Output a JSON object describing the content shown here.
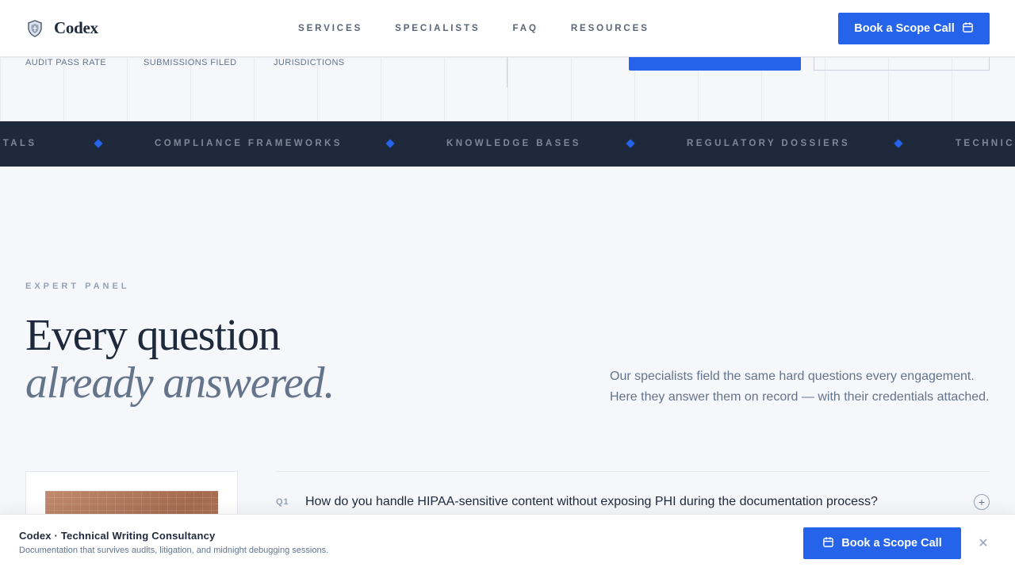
{
  "header": {
    "brand_name": "Codex",
    "nav": [
      "Services",
      "Specialists",
      "FAQ",
      "Resources"
    ],
    "cta_label": "Book a Scope Call"
  },
  "hero_stats": {
    "labels": [
      "Audit Pass Rate",
      "Submissions Filed",
      "Jurisdictions"
    ]
  },
  "ticker": {
    "items": [
      "RTALS",
      "COMPLIANCE FRAMEWORKS",
      "KNOWLEDGE BASES",
      "REGULATORY DOSSIERS",
      "TECHNICA"
    ]
  },
  "expert_panel": {
    "eyebrow": "Expert Panel",
    "headline_line1": "Every question",
    "headline_line2": "already answered.",
    "lede": "Our specialists field the same hard questions every engagement. Here they answer them on record — with their credentials attached."
  },
  "faq": [
    {
      "number": "Q1",
      "question": "How do you handle HIPAA-sensitive content without exposing PHI during the documentation process?",
      "toggle": "+"
    }
  ],
  "sticky_bar": {
    "title": "Codex · Technical Writing Consultancy",
    "subtitle": "Documentation that survives audits, litigation, and midnight debugging sessions.",
    "cta_label": "Book a Scope Call",
    "close_glyph": "✕"
  },
  "colors": {
    "accent": "#2563eb",
    "ink": "#1e293b",
    "muted": "#64748b",
    "band": "#1e293b",
    "page": "#f5f7fa"
  },
  "icons": {
    "logo": "shield-icon",
    "cta": "calendar-icon",
    "close": "close-icon",
    "toggle": "plus-circle-icon"
  }
}
